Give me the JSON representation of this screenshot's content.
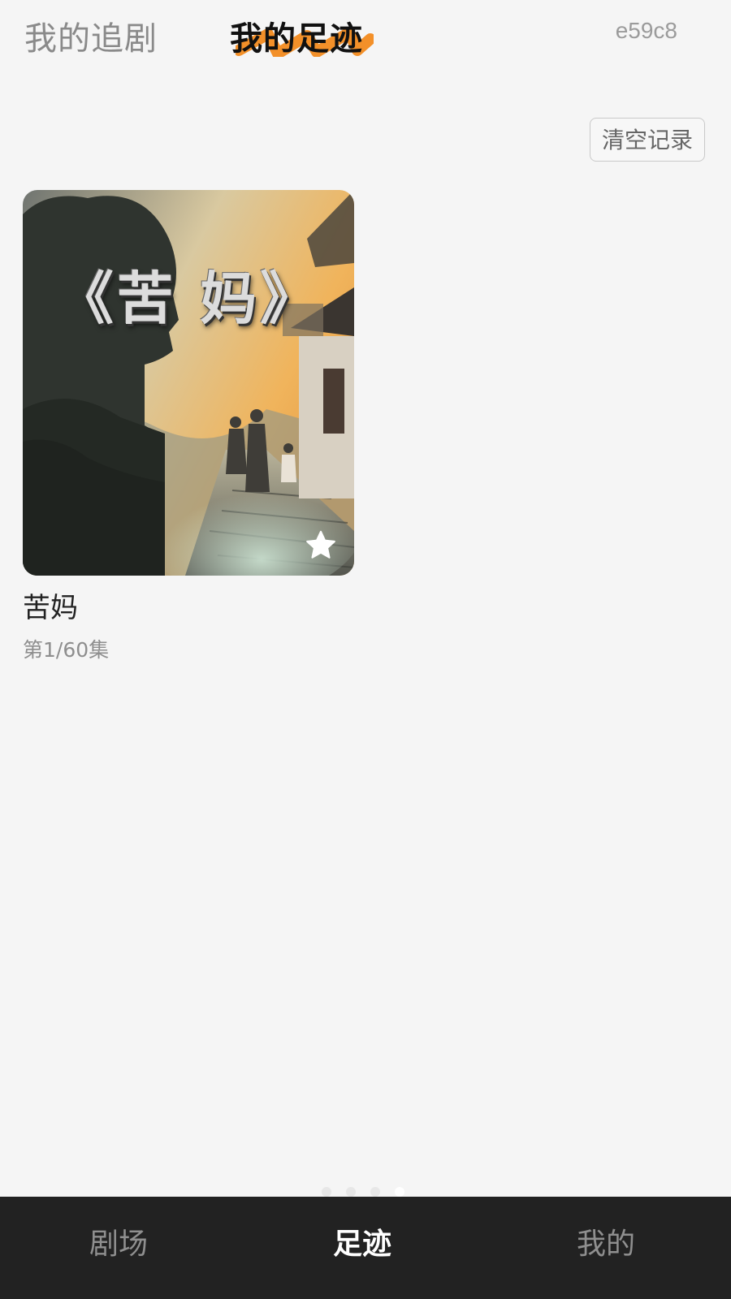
{
  "header": {
    "tabs": [
      {
        "label": "我的追剧",
        "active": false
      },
      {
        "label": "我的足迹",
        "active": true
      }
    ],
    "user_id": "e59c8",
    "accent_color": "#f28a1e"
  },
  "actions": {
    "clear_label": "清空记录"
  },
  "history": [
    {
      "title": "苦妈",
      "episode_progress": "第1/60集",
      "poster_title": "《苦 妈》",
      "favorited": true,
      "favorite_icon": "star-icon"
    }
  ],
  "pager": {
    "dot_count": 4,
    "active_index": 3
  },
  "bottom_nav": {
    "items": [
      {
        "label": "剧场",
        "active": false
      },
      {
        "label": "足迹",
        "active": true
      },
      {
        "label": "我的",
        "active": false
      }
    ],
    "background": "#222222"
  }
}
